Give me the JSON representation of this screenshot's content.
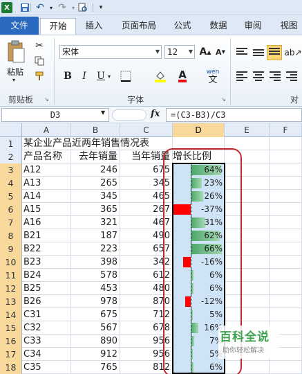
{
  "quick_access": {
    "logo": "X"
  },
  "tabs": [
    "文件",
    "开始",
    "插入",
    "页面布局",
    "公式",
    "数据",
    "审阅",
    "视图"
  ],
  "ribbon": {
    "clipboard": {
      "paste_label": "粘贴",
      "group_label": "剪贴板"
    },
    "font": {
      "font_name": "宋体",
      "font_size": "12",
      "bold": "B",
      "italic": "I",
      "underline": "U",
      "group_label": "字体",
      "wen": "wén",
      "wen_char": "文"
    },
    "alignment": {
      "group_label": "对齐"
    }
  },
  "formula_bar": {
    "name_box": "D3",
    "fx": "fx",
    "formula": "=(C3-B3)/C3"
  },
  "columns": [
    "A",
    "B",
    "C",
    "D",
    "E",
    "F"
  ],
  "rows": [
    {
      "n": "1",
      "a": "某企业产品近两年销售情况表"
    },
    {
      "n": "2",
      "a": "产品名称",
      "b": "去年销量",
      "c": "当年销量",
      "d": "增长比例"
    },
    {
      "n": "3",
      "a": "A12",
      "b": "246",
      "c": "675",
      "pct": "64%",
      "v": 0.64
    },
    {
      "n": "4",
      "a": "A13",
      "b": "265",
      "c": "345",
      "pct": "23%",
      "v": 0.23
    },
    {
      "n": "5",
      "a": "A14",
      "b": "345",
      "c": "465",
      "pct": "26%",
      "v": 0.26
    },
    {
      "n": "6",
      "a": "A15",
      "b": "365",
      "c": "267",
      "pct": "-37%",
      "v": -0.37
    },
    {
      "n": "7",
      "a": "A16",
      "b": "321",
      "c": "467",
      "pct": "31%",
      "v": 0.31
    },
    {
      "n": "8",
      "a": "B21",
      "b": "187",
      "c": "490",
      "pct": "62%",
      "v": 0.62
    },
    {
      "n": "9",
      "a": "B22",
      "b": "223",
      "c": "657",
      "pct": "66%",
      "v": 0.66
    },
    {
      "n": "10",
      "a": "B23",
      "b": "398",
      "c": "342",
      "pct": "-16%",
      "v": -0.16
    },
    {
      "n": "11",
      "a": "B24",
      "b": "578",
      "c": "612",
      "pct": "6%",
      "v": 0.06
    },
    {
      "n": "12",
      "a": "B25",
      "b": "453",
      "c": "480",
      "pct": "6%",
      "v": 0.06
    },
    {
      "n": "13",
      "a": "B26",
      "b": "978",
      "c": "870",
      "pct": "-12%",
      "v": -0.12
    },
    {
      "n": "14",
      "a": "C31",
      "b": "675",
      "c": "712",
      "pct": "5%",
      "v": 0.05
    },
    {
      "n": "15",
      "a": "C32",
      "b": "567",
      "c": "678",
      "pct": "16%",
      "v": 0.16
    },
    {
      "n": "16",
      "a": "C33",
      "b": "890",
      "c": "956",
      "pct": "7%",
      "v": 0.07
    },
    {
      "n": "17",
      "a": "C34",
      "b": "912",
      "c": "956",
      "pct": "5%",
      "v": 0.05
    },
    {
      "n": "18",
      "a": "C35",
      "b": "765",
      "c": "812",
      "pct": "6%",
      "v": 0.06
    }
  ],
  "colors": {
    "positive_bar": "#4aa56a",
    "negative_bar": "#ff0000",
    "selection_header": "#f9d99b",
    "highlight_outline": "#c0282e"
  },
  "watermark": {
    "title": "百科全说",
    "subtitle": "助你轻松解决"
  }
}
